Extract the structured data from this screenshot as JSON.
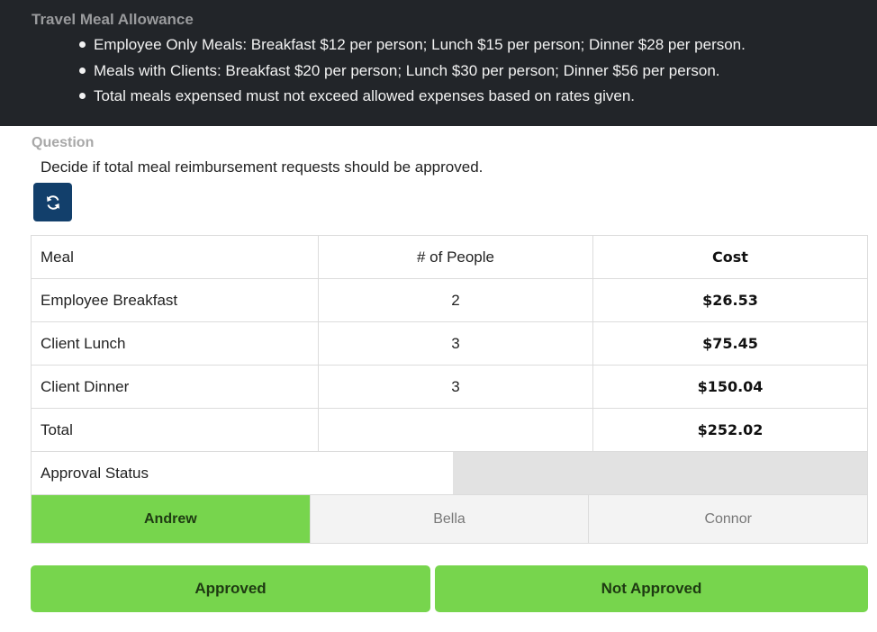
{
  "header": {
    "title": "Travel Meal Allowance",
    "rules": [
      "Employee Only Meals: Breakfast $12 per person; Lunch $15 per person; Dinner $28 per person.",
      "Meals with Clients: Breakfast $20 per person; Lunch $30 per person; Dinner $56 per person.",
      "Total meals expensed must not exceed allowed expenses based on rates given."
    ]
  },
  "question": {
    "label": "Question",
    "text": "Decide if total meal reimbursement requests should be approved.",
    "refresh_icon": "refresh-icon"
  },
  "table": {
    "headers": [
      "Meal",
      "# of People",
      "Cost"
    ],
    "rows": [
      {
        "meal": "Employee Breakfast",
        "people": "2",
        "cost": "$26.53"
      },
      {
        "meal": "Client Lunch",
        "people": "3",
        "cost": "$75.45"
      },
      {
        "meal": "Client Dinner",
        "people": "3",
        "cost": "$150.04"
      }
    ],
    "total": {
      "label": "Total",
      "people": "",
      "cost": "$252.02"
    },
    "approval_status": {
      "label": "Approval Status",
      "value": ""
    }
  },
  "people_tabs": [
    {
      "name": "Andrew",
      "active": true
    },
    {
      "name": "Bella",
      "active": false
    },
    {
      "name": "Connor",
      "active": false
    }
  ],
  "actions": {
    "approved_label": "Approved",
    "not_approved_label": "Not Approved"
  },
  "colors": {
    "header_bg": "#222529",
    "accent_green": "#77d54d",
    "refresh_button": "#123f6b"
  }
}
